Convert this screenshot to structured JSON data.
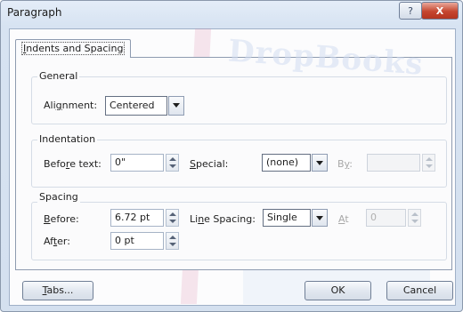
{
  "window": {
    "title": "Paragraph",
    "help_glyph": "?",
    "close_glyph": "X"
  },
  "tabs": [
    {
      "label": "Indents and Spacing",
      "selected": true
    }
  ],
  "general": {
    "heading": "General",
    "alignment_label": "Alignment:",
    "alignment_value": "Centered"
  },
  "indentation": {
    "heading": "Indentation",
    "before_text_label": "Before text:",
    "before_text_value": "0\"",
    "special_label": "Special:",
    "special_value": "(none)",
    "by_label": "By:",
    "by_value": ""
  },
  "spacing": {
    "heading": "Spacing",
    "before_label": "Before:",
    "before_value": "6.72 pt",
    "after_label": "After:",
    "after_value": "0 pt",
    "line_spacing_label": "Line Spacing:",
    "line_spacing_value": "Single",
    "at_label": "At",
    "at_value": "0"
  },
  "buttons": {
    "tabs": "Tabs...",
    "ok": "OK",
    "cancel": "Cancel"
  },
  "watermark": {
    "text": "DropBooks"
  },
  "colors": {
    "accent": "#c5462f",
    "frame": "#8a98ac",
    "panel": "#fbfbfc"
  }
}
